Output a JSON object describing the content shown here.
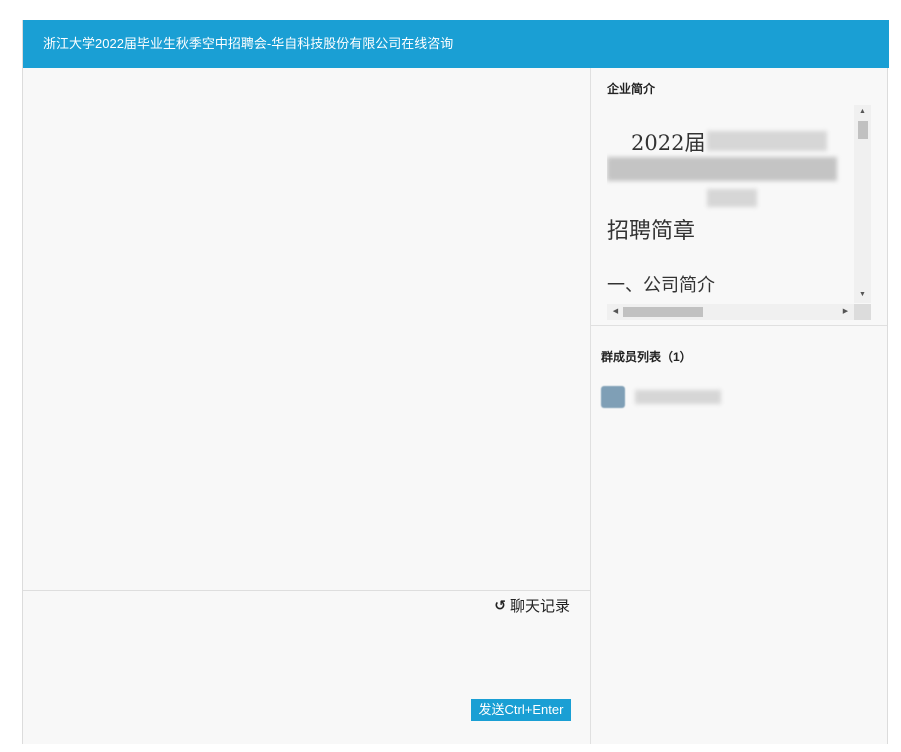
{
  "window": {
    "title": "浙江大学2022届毕业生秋季空中招聘会-华自科技股份有限公司在线咨询"
  },
  "chat": {
    "history_icon": "↺",
    "history_label": "聊天记录",
    "send_label": "发送Ctrl+Enter"
  },
  "intro": {
    "title": "企业简介",
    "doc_line1": "2022届",
    "doc_heading": "招聘简章",
    "doc_section": "一、公司简介"
  },
  "members": {
    "title": "群成员列表（1）",
    "count": 1
  },
  "colors": {
    "accent": "#1a9fd4",
    "panel_bg": "#f8f8f8"
  },
  "icons": [
    "history-icon",
    "scroll-up-arrow",
    "scroll-down-arrow",
    "scroll-left-arrow",
    "scroll-right-arrow"
  ]
}
